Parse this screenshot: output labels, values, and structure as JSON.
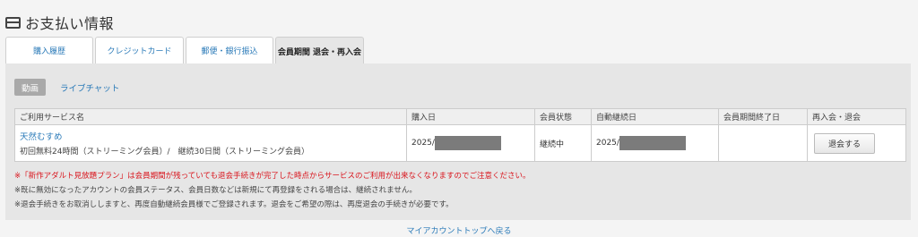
{
  "header": {
    "title": "お支払い情報",
    "icon": "credit-card-icon"
  },
  "tabs": [
    {
      "label": "購入履歴",
      "active": false
    },
    {
      "label": "クレジットカード",
      "active": false
    },
    {
      "label": "郵便・銀行振込",
      "active": false
    },
    {
      "label": "会員期間 退会・再入会",
      "active": true
    }
  ],
  "subtabs": [
    {
      "label": "動画",
      "active": true
    },
    {
      "label": "ライブチャット",
      "active": false
    }
  ],
  "table": {
    "headers": [
      "ご利用サービス名",
      "購入日",
      "会員状態",
      "自動継続日",
      "会員期間終了日",
      "再入会・退会"
    ],
    "rows": [
      {
        "service_name": "天然むすめ",
        "service_desc": "初回無料24時間（ストリーミング会員）/　継続30日間（ストリーミング会員）",
        "purchase_date": "2025/",
        "status": "継続中",
        "auto_renew_date": "2025/",
        "end_date": "",
        "action_label": "退会する"
      }
    ]
  },
  "notes": {
    "warning": "※「新作アダルト見放題プラン」は会員期間が残っていても退会手続きが完了した時点からサービスのご利用が出来なくなりますのでご注意ください。",
    "note1": "※既に無効になったアカウントの会員ステータス、会員日数などは新規にて再登録をされる場合は、継続されません。",
    "note2": "※退会手続きをお取消ししますと、再度自動継続会員様でご登録されます。退会をご希望の際は、再度退会の手続きが必要です。"
  },
  "footer": {
    "link_label": "マイアカウントトップへ戻る"
  },
  "colors": {
    "link": "#2a7ab8",
    "warning": "#d9141c",
    "panel": "#e6e6e6"
  }
}
